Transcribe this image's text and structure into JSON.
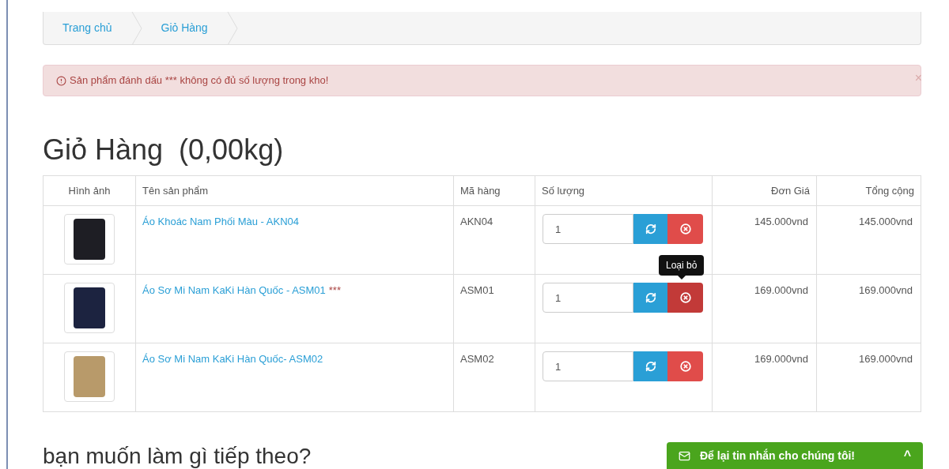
{
  "breadcrumb": [
    {
      "label": "Trang chủ"
    },
    {
      "label": "Giỏ Hàng"
    }
  ],
  "alert": {
    "message": "Sản phẩm đánh dấu *** không có đủ số lượng trong kho!",
    "close": "×"
  },
  "heading": "Giỏ Hàng  (0,00kg)",
  "table": {
    "columns": [
      "Hình ảnh",
      "Tên sản phẩm",
      "Mã hàng",
      "Số lượng",
      "Đơn Giá",
      "Tổng cộng"
    ],
    "rows": [
      {
        "name": "Áo Khoác Nam Phối Màu - AKN04",
        "marker": "",
        "code": "AKN04",
        "quantity": "1",
        "price": "145.000vnd",
        "total": "145.000vnd",
        "tooltip": ""
      },
      {
        "name": "Áo Sơ Mi Nam KaKi Hàn Quốc - ASM01",
        "marker": "***",
        "code": "ASM01",
        "quantity": "1",
        "price": "169.000vnd",
        "total": "169.000vnd",
        "tooltip": "Loại bỏ"
      },
      {
        "name": "Áo Sơ Mi Nam KaKi Hàn Quốc- ASM02",
        "marker": "",
        "code": "ASM02",
        "quantity": "1",
        "price": "169.000vnd",
        "total": "169.000vnd",
        "tooltip": ""
      }
    ]
  },
  "next_heading": "bạn muốn làm gì tiếp theo?",
  "chat_widget": {
    "label": "Để lại tin nhắn cho chúng tôi!",
    "caret": "^"
  }
}
